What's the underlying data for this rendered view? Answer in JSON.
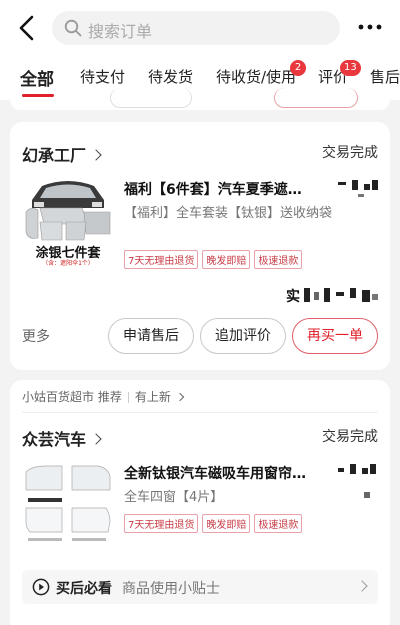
{
  "header": {
    "search_placeholder": "搜索订单"
  },
  "tabs": [
    {
      "label": "全部",
      "active": true
    },
    {
      "label": "待支付"
    },
    {
      "label": "待发货"
    },
    {
      "label": "待收货/使用",
      "badge": "2"
    },
    {
      "label": "评价",
      "badge": "13"
    },
    {
      "label": "售后"
    }
  ],
  "orders": [
    {
      "shop": "幻承工厂",
      "status": "交易完成",
      "product_title": "福利【6件套】汽车夏季遮…",
      "product_spec": "【福利】全车套装【钛银】送收纳袋",
      "tags": [
        "7天无理由退货",
        "晚发即赔",
        "极速退款"
      ],
      "image_caption": "涂银七件套",
      "image_subcaption": "（含：遮阳伞1个）",
      "paid_prefix": "实",
      "more": "更多",
      "buttons": [
        "申请售后",
        "追加评价",
        "再买一单"
      ]
    },
    {
      "shop": "众芸汽车",
      "status": "交易完成",
      "product_title": "全新钛银汽车磁吸车用窗帘…",
      "product_spec": "全车四窗【4片】",
      "tags": [
        "7天无理由退货",
        "晚发即赔",
        "极速退款"
      ],
      "recommend": [
        "小姑百货超市 推荐",
        "有上新"
      ],
      "tip_title": "买后必看",
      "tip_text": "商品使用小贴士"
    }
  ],
  "colors": {
    "accent": "#e0202a",
    "tag": "#c83c46"
  }
}
